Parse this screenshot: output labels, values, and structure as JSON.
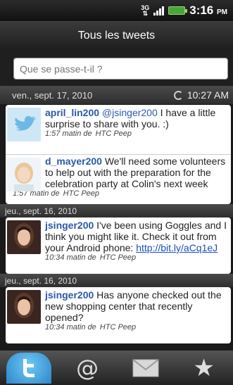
{
  "status": {
    "network": "3G",
    "time_main": "3:16",
    "time_suffix": "PM"
  },
  "title": "Tous les tweets",
  "compose": {
    "placeholder": "Que se passe-t-il ?"
  },
  "groups": [
    {
      "date": "ven., sept. 17, 2010",
      "refresh_time": "10:27 AM",
      "tweets": [
        {
          "user": "april_lin200",
          "mention": "@jsinger200",
          "text": " I have a little surprise to share with you. :)",
          "time": "1:57 matin de",
          "source": "HTC Peep"
        },
        {
          "user": "d_mayer200",
          "text": " We'll need some volunteers to help out with the preparation for the celebration party at Colin's next week",
          "time": "1:57 matin de",
          "source": "HTC Peep"
        }
      ]
    },
    {
      "date": "jeu., sept. 16, 2010",
      "tweets": [
        {
          "user": "jsinger200",
          "text": " I've been using Goggles and I think you might like it. Check it out from your Android phone: ",
          "link": "http://bit.ly/aCq1eJ",
          "time": "10:34 matin de",
          "source": "HTC Peep"
        }
      ]
    },
    {
      "date": "jeu., sept. 16, 2010",
      "tweets": [
        {
          "user": "jsinger200",
          "text": " Has anyone checked out the new shopping center that recently opened?",
          "time": "10:34 matin de",
          "source": "HTC Peep"
        }
      ]
    }
  ],
  "tabs": [
    {
      "icon": "twitter-bird-icon",
      "active": true
    },
    {
      "icon": "at-mentions-icon",
      "active": false
    },
    {
      "icon": "mail-icon",
      "active": false
    },
    {
      "icon": "star-icon",
      "active": false
    }
  ],
  "colors": {
    "username": "#2a59a8",
    "link": "#1a4fc4",
    "active_tab": "#2d87c9"
  }
}
